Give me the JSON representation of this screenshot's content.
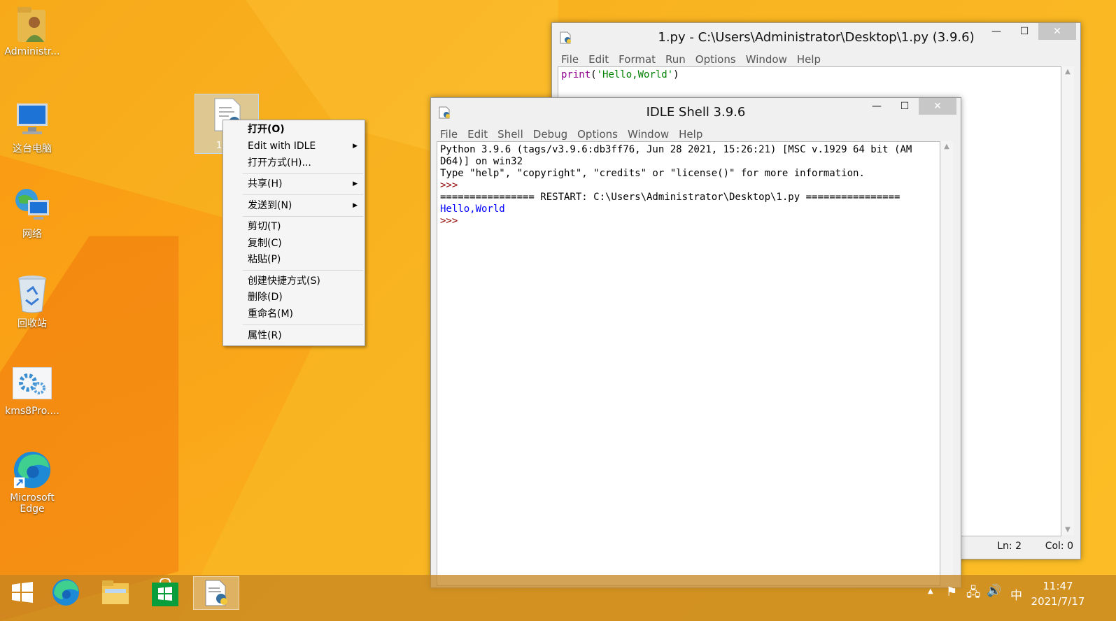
{
  "desktop_icons": [
    {
      "label": "Administr...",
      "icon": "user-folder-icon"
    },
    {
      "label": "这台电脑",
      "icon": "computer-icon"
    },
    {
      "label": "网络",
      "icon": "network-icon"
    },
    {
      "label": "回收站",
      "icon": "recycle-bin-icon"
    },
    {
      "label": "kms8Pro....",
      "icon": "settings-gear-icon"
    },
    {
      "label": "Microsoft Edge",
      "icon": "edge-icon"
    }
  ],
  "selected_file_label": "1.",
  "context_menu": {
    "items": [
      {
        "label": "打开(O)",
        "bold": true
      },
      {
        "label": "Edit with IDLE",
        "submenu": true
      },
      {
        "label": "打开方式(H)..."
      },
      {
        "label": "共享(H)",
        "submenu": true
      },
      {
        "label": "发送到(N)",
        "submenu": true
      },
      {
        "label": "剪切(T)"
      },
      {
        "label": "复制(C)"
      },
      {
        "label": "粘贴(P)"
      },
      {
        "label": "创建快捷方式(S)"
      },
      {
        "label": "删除(D)"
      },
      {
        "label": "重命名(M)"
      },
      {
        "label": "属性(R)"
      }
    ],
    "submenu_glyph": "▶"
  },
  "editor_window": {
    "title": "1.py - C:\\Users\\Administrator\\Desktop\\1.py (3.9.6)",
    "menu": [
      "File",
      "Edit",
      "Format",
      "Run",
      "Options",
      "Window",
      "Help"
    ],
    "code": {
      "keyword": "print",
      "open": "(",
      "string": "'Hello,World'",
      "close": ")"
    },
    "status": {
      "ln": "Ln: 2",
      "col": "Col: 0"
    }
  },
  "shell_window": {
    "title": "IDLE Shell 3.9.6",
    "menu": [
      "File",
      "Edit",
      "Shell",
      "Debug",
      "Options",
      "Window",
      "Help"
    ],
    "lines": {
      "line1": "Python 3.9.6 (tags/v3.9.6:db3ff76, Jun 28 2021, 15:26:21) [MSC v.1929 64 bit (AM",
      "line2": "D64)] on win32",
      "line3": "Type \"help\", \"copyright\", \"credits\" or \"license()\" for more information.",
      "prompt1": ">>>",
      "restart": "================ RESTART: C:\\Users\\Administrator\\Desktop\\1.py ================",
      "output": "Hello,World",
      "prompt2": ">>>"
    }
  },
  "window_controls": {
    "minimize": "—",
    "maximize": "☐",
    "close": "✕"
  },
  "taskbar": {
    "buttons": [
      "windows-start-icon",
      "edge-icon",
      "file-explorer-icon",
      "store-icon",
      "python-idle-icon"
    ],
    "tray": {
      "up_arrow": "▲",
      "flag": "⚑",
      "network": "🖧",
      "volume": "🔊",
      "ime": "中",
      "time": "11:47",
      "date": "2021/7/17"
    }
  },
  "colors": {
    "wallpaper": "#f9b522",
    "keyword": "#900090",
    "string": "#008000",
    "output": "#0000ff",
    "prompt": "#900000"
  }
}
